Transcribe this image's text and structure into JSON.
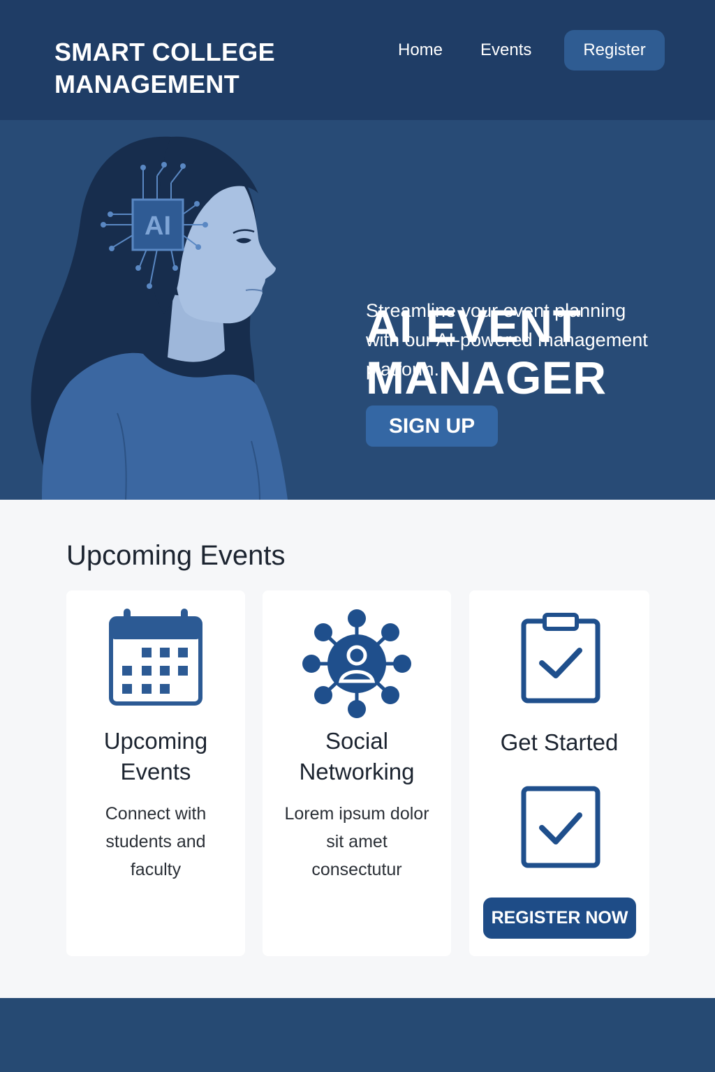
{
  "header": {
    "brand_line1": "SMART COLLEGE",
    "brand_line2": "MANAGEMENT",
    "nav": {
      "home": "Home",
      "events": "Events",
      "register": "Register"
    }
  },
  "hero": {
    "title_line1": "AI EVENT",
    "title_line2": "MANAGER",
    "subtitle": "Streamline your event planning with our AI-powered management platform.",
    "chip_label": "AI",
    "signup_label": "SIGN UP"
  },
  "events_section": {
    "title": "Upcoming Events",
    "cards": [
      {
        "icon": "calendar-icon",
        "heading_line1": "Upcoming",
        "heading_line2": "Events",
        "body_line1": "Connect with",
        "body_line2": "students and",
        "body_line3": "faculty"
      },
      {
        "icon": "network-icon",
        "heading_line1": "Social",
        "heading_line2": "Networking",
        "body_line1": "Lorem ipsum dolor",
        "body_line2": "sit amet",
        "body_line3": "consectutur"
      },
      {
        "icon": "clipboard-check-icon",
        "heading": "Get Started",
        "secondary_icon": "checkbox-icon",
        "button_label": "REGISTER NOW"
      }
    ]
  },
  "colors": {
    "navbar": "#1f3d66",
    "hero": "#284b76",
    "accent": "#3467a4",
    "icon": "#2c5a94",
    "button_dark": "#1e4c87",
    "footer": "#264a73"
  }
}
